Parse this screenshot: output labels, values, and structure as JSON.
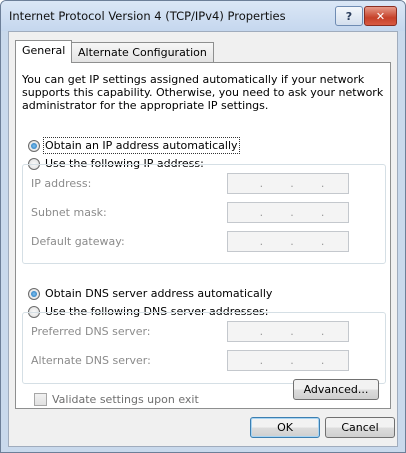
{
  "window": {
    "title": "Internet Protocol Version 4 (TCP/IPv4) Properties",
    "help_label": "?",
    "close_label": "✕"
  },
  "tabs": [
    {
      "label": "General"
    },
    {
      "label": "Alternate Configuration"
    }
  ],
  "description": "You can get IP settings assigned automatically if your network supports this capability. Otherwise, you need to ask your network administrator for the appropriate IP settings.",
  "ip": {
    "auto_label": "Obtain an IP address automatically",
    "manual_label": "Use the following IP address:",
    "fields": [
      {
        "label": "IP address:"
      },
      {
        "label": "Subnet mask:"
      },
      {
        "label": "Default gateway:"
      }
    ]
  },
  "dns": {
    "auto_label": "Obtain DNS server address automatically",
    "manual_label": "Use the following DNS server addresses:",
    "fields": [
      {
        "label": "Preferred DNS server:"
      },
      {
        "label": "Alternate DNS server:"
      }
    ]
  },
  "validate_label": "Validate settings upon exit",
  "buttons": {
    "advanced": "Advanced...",
    "ok": "OK",
    "cancel": "Cancel"
  }
}
